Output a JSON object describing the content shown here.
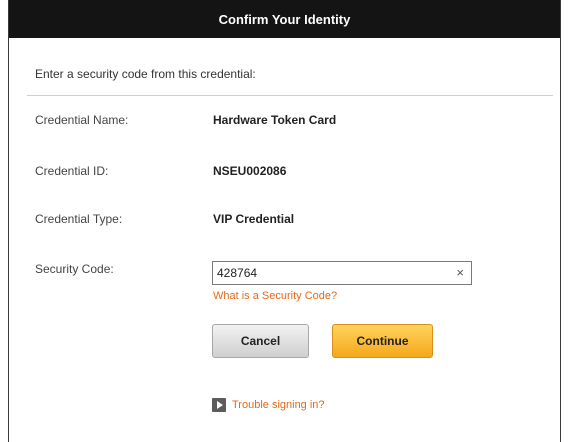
{
  "dialog": {
    "title": "Confirm Your Identity",
    "instruction": "Enter a security code from this credential:"
  },
  "credential": {
    "name_label": "Credential Name:",
    "name_value": "Hardware Token Card",
    "id_label": "Credential ID:",
    "id_value": "NSEU002086",
    "type_label": "Credential Type:",
    "type_value": "VIP Credential"
  },
  "security_code": {
    "label": "Security Code:",
    "value": "428764",
    "clear_symbol": "×",
    "help_link": "What is a Security Code?"
  },
  "buttons": {
    "cancel": "Cancel",
    "continue": "Continue"
  },
  "trouble": {
    "label": "Trouble signing in?",
    "icon": "play-icon"
  },
  "colors": {
    "titlebar": "#141414",
    "link": "#e26a1b",
    "continue": "#f5a81c"
  }
}
